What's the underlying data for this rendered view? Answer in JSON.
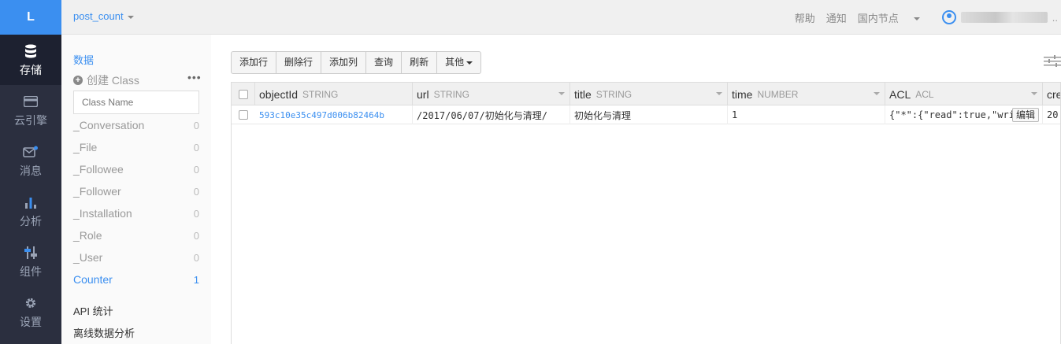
{
  "nav": {
    "logo": "L",
    "items": [
      {
        "label": "存储",
        "icon": "database-icon",
        "active": true
      },
      {
        "label": "云引擎",
        "icon": "cloud-engine-icon"
      },
      {
        "label": "消息",
        "icon": "message-icon"
      },
      {
        "label": "分析",
        "icon": "bar-chart-icon"
      },
      {
        "label": "组件",
        "icon": "sliders-icon"
      },
      {
        "label": "设置",
        "icon": "gear-icon"
      }
    ]
  },
  "topbar": {
    "app_name": "post_count",
    "help": "帮助",
    "notify": "通知",
    "region": "国内节点",
    "user_suffix": ".."
  },
  "sidebar": {
    "title": "数据",
    "create_class": "创建 Class",
    "more": "•••",
    "class_name_placeholder": "Class Name",
    "classes": [
      {
        "name": "_Conversation",
        "count": "0"
      },
      {
        "name": "_File",
        "count": "0"
      },
      {
        "name": "_Followee",
        "count": "0"
      },
      {
        "name": "_Follower",
        "count": "0"
      },
      {
        "name": "_Installation",
        "count": "0"
      },
      {
        "name": "_Role",
        "count": "0"
      },
      {
        "name": "_User",
        "count": "0"
      },
      {
        "name": "Counter",
        "count": "1",
        "active": true
      }
    ],
    "api_stats": "API 统计",
    "offline_analysis": "离线数据分析"
  },
  "toolbar": {
    "add_row": "添加行",
    "delete_row": "删除行",
    "add_column": "添加列",
    "query": "查询",
    "refresh": "刷新",
    "other": "其他"
  },
  "table": {
    "columns": [
      {
        "name": "objectId",
        "type": "STRING"
      },
      {
        "name": "url",
        "type": "STRING"
      },
      {
        "name": "title",
        "type": "STRING"
      },
      {
        "name": "time",
        "type": "NUMBER"
      },
      {
        "name": "ACL",
        "type": "ACL"
      },
      {
        "name": "cre",
        "type": ""
      }
    ],
    "rows": [
      {
        "objectId": "593c10e35c497d006b82464b",
        "url": "/2017/06/07/初始化与清理/",
        "title": "初始化与清理",
        "time": "1",
        "acl": "{\"*\":{\"read\":true,\"wri…",
        "edit": "编辑",
        "created": "20"
      }
    ]
  },
  "colors": {
    "accent": "#3b8ff0",
    "nav_bg": "#2b2f3f",
    "nav_active_bg": "#1d2130"
  }
}
